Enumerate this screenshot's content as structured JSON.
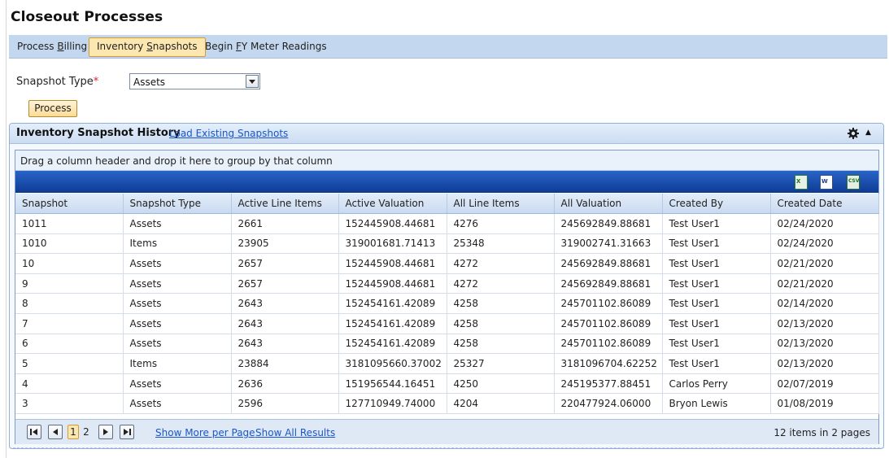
{
  "page": {
    "title": "Closeout Processes"
  },
  "tabs": [
    {
      "before": "Process ",
      "accel": "B",
      "after": "illing",
      "active": false
    },
    {
      "before": "Inventory ",
      "accel": "S",
      "after": "napshots",
      "active": true
    },
    {
      "before": "Begin ",
      "accel": "F",
      "after": "Y Meter Readings",
      "active": false
    }
  ],
  "form": {
    "snapshot_type_label": "Snapshot Type",
    "required_mark": "*",
    "snapshot_type_value": "Assets",
    "process_label": "Process"
  },
  "panel": {
    "title": "Inventory Snapshot History",
    "load_link": "Load Existing Snapshots",
    "group_hint": "Drag a column header and drop it here to group by that column",
    "export_icons": [
      "excel-export-icon",
      "word-export-icon",
      "csv-export-icon"
    ]
  },
  "table": {
    "columns": [
      "Snapshot",
      "Snapshot Type",
      "Active Line Items",
      "Active Valuation",
      "All Line Items",
      "All Valuation",
      "Created By",
      "Created Date"
    ],
    "rows": [
      [
        "1011",
        "Assets",
        "2661",
        "152445908.44681",
        "4276",
        "245692849.88681",
        "Test User1",
        "02/24/2020"
      ],
      [
        "1010",
        "Items",
        "23905",
        "319001681.71413",
        "25348",
        "319002741.31663",
        "Test User1",
        "02/24/2020"
      ],
      [
        "10",
        "Assets",
        "2657",
        "152445908.44681",
        "4272",
        "245692849.88681",
        "Test User1",
        "02/21/2020"
      ],
      [
        "9",
        "Assets",
        "2657",
        "152445908.44681",
        "4272",
        "245692849.88681",
        "Test User1",
        "02/21/2020"
      ],
      [
        "8",
        "Assets",
        "2643",
        "152454161.42089",
        "4258",
        "245701102.86089",
        "Test User1",
        "02/14/2020"
      ],
      [
        "7",
        "Assets",
        "2643",
        "152454161.42089",
        "4258",
        "245701102.86089",
        "Test User1",
        "02/13/2020"
      ],
      [
        "6",
        "Assets",
        "2643",
        "152454161.42089",
        "4258",
        "245701102.86089",
        "Test User1",
        "02/13/2020"
      ],
      [
        "5",
        "Items",
        "23884",
        "3181095660.37002",
        "25327",
        "3181096704.62252",
        "Test User1",
        "02/13/2020"
      ],
      [
        "4",
        "Assets",
        "2636",
        "151956544.16451",
        "4250",
        "245195377.88451",
        "Carlos Perry",
        "02/07/2019"
      ],
      [
        "3",
        "Assets",
        "2596",
        "127710949.74000",
        "4204",
        "220477924.06000",
        "Bryon Lewis",
        "01/08/2019"
      ]
    ]
  },
  "pager": {
    "pages": [
      "1",
      "2"
    ],
    "current_page": "1",
    "show_more": "Show More per Page",
    "show_all": "Show All Results",
    "info": "12 items in 2 pages"
  },
  "colors": {
    "accent_orange": "#fde7b0",
    "tab_bar": "#c3d7ef",
    "toolbar_blue": "#0d3b93",
    "link_blue": "#1a56c8",
    "required_red": "#d8262f"
  }
}
